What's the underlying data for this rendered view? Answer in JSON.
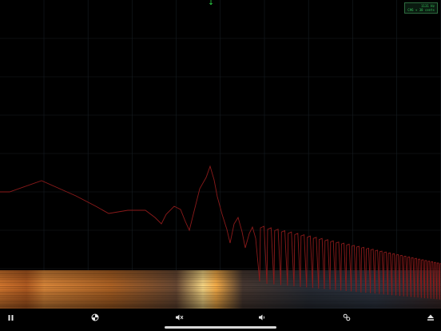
{
  "readout": {
    "line1": "1131 Hz",
    "line2": "C#6 + 38 cents"
  },
  "toolbar": {
    "icons": [
      "pause-icon",
      "color-palette-icon",
      "audio-settings-icon",
      "volume-icon",
      "link-settings-icon",
      "eject-icon"
    ]
  },
  "colors": {
    "background": "#000000",
    "spectrum_line": "#8b1a1a",
    "grid": "#1a2228",
    "spectrogram_hot": "#ffd27a",
    "marker": "#2ee04a"
  }
}
